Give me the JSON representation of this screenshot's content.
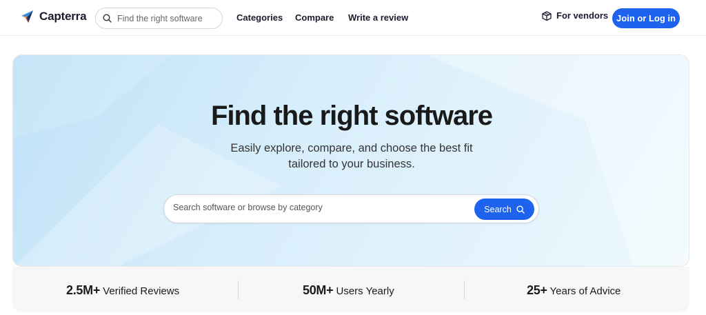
{
  "header": {
    "logo_text": "Capterra",
    "search_placeholder": "Find the right software",
    "nav": [
      "Categories",
      "Compare",
      "Write a review"
    ],
    "vendors_label": "For vendors",
    "login_label": "Join or Log in"
  },
  "hero": {
    "title": "Find the right software",
    "subtitle_line1": "Easily explore, compare, and choose the best fit",
    "subtitle_line2": "tailored to your business.",
    "search_placeholder": "Search software or browse by category",
    "search_button": "Search"
  },
  "stats": [
    {
      "value": "2.5M+",
      "label": "Verified Reviews"
    },
    {
      "value": "50M+",
      "label": "Users Yearly"
    },
    {
      "value": "25+",
      "label": "Years of Advice"
    }
  ],
  "colors": {
    "accent": "#1d63ed",
    "logo_yellow": "#ffa726",
    "logo_blue": "#3d8bd9",
    "logo_navy": "#1b2f5b",
    "logo_red": "#e53935"
  },
  "icons": {
    "top_search": "search-icon",
    "vendors": "box-icon",
    "hero_search": "search-icon",
    "logo": "capterra-logo-icon"
  }
}
